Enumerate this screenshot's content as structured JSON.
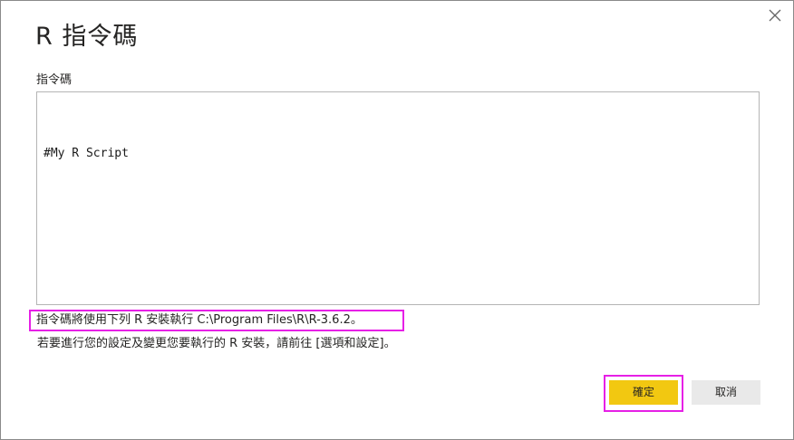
{
  "dialog": {
    "title": "R 指令碼",
    "close_icon": "close-icon"
  },
  "script": {
    "label": "指令碼",
    "content": "#My R Script"
  },
  "info": {
    "install_line": "指令碼將使用下列 R 安裝執行 C:\\Program Files\\R\\R-3.6.2。",
    "settings_line": "若要進行您的設定及變更您要執行的 R 安裝，請前往 [選項和設定]。"
  },
  "buttons": {
    "ok_label": "確定",
    "cancel_label": "取消"
  },
  "colors": {
    "primary_button": "#f2c811",
    "secondary_button": "#e9e9e9",
    "highlight": "#e620e6"
  }
}
